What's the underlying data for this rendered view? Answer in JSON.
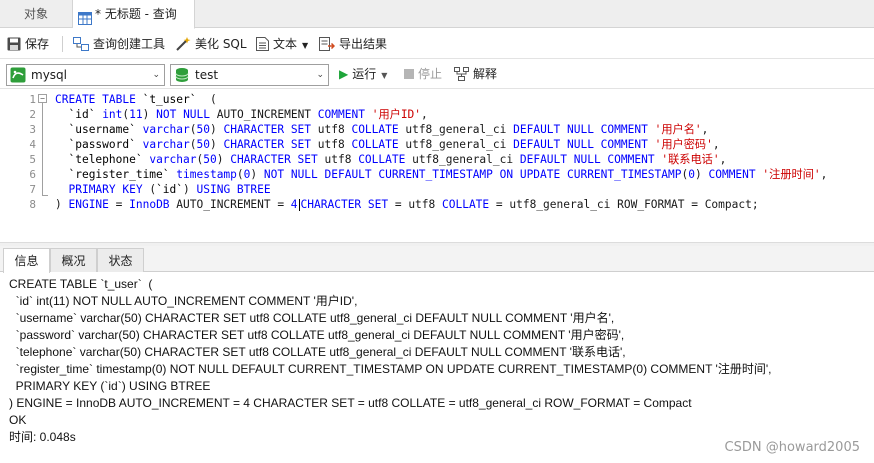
{
  "tabs": {
    "objects": "对象",
    "query": "* 无标题 - 查询"
  },
  "toolbar": {
    "save": "保存",
    "query_builder": "查询创建工具",
    "beautify_sql": "美化 SQL",
    "text": "文本",
    "export": "导出结果"
  },
  "connection": {
    "server": "mysql",
    "database": "test"
  },
  "actions": {
    "run": "运行",
    "stop": "停止",
    "explain": "解释"
  },
  "editor": {
    "line_numbers": [
      "1",
      "2",
      "3",
      "4",
      "5",
      "6",
      "7",
      "8"
    ]
  },
  "result_tabs": {
    "info": "信息",
    "overview": "概况",
    "status": "状态"
  },
  "messages": {
    "lines": [
      "CREATE TABLE `t_user`  (",
      "  `id` int(11) NOT NULL AUTO_INCREMENT COMMENT '用户ID',",
      "  `username` varchar(50) CHARACTER SET utf8 COLLATE utf8_general_ci DEFAULT NULL COMMENT '用户名',",
      "  `password` varchar(50) CHARACTER SET utf8 COLLATE utf8_general_ci DEFAULT NULL COMMENT '用户密码',",
      "  `telephone` varchar(50) CHARACTER SET utf8 COLLATE utf8_general_ci DEFAULT NULL COMMENT '联系电话',",
      "  `register_time` timestamp(0) NOT NULL DEFAULT CURRENT_TIMESTAMP ON UPDATE CURRENT_TIMESTAMP(0) COMMENT '注册时间',",
      "  PRIMARY KEY (`id`) USING BTREE",
      ") ENGINE = InnoDB AUTO_INCREMENT = 4 CHARACTER SET = utf8 COLLATE = utf8_general_ci ROW_FORMAT = Compact",
      "OK",
      "时间: 0.048s"
    ]
  },
  "watermark": "CSDN @howard2005"
}
